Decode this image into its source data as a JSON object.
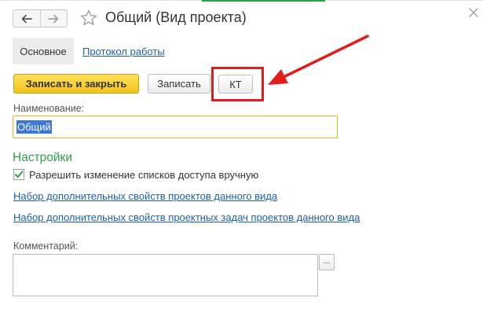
{
  "window": {
    "title": "Общий (Вид проекта)"
  },
  "icons": {
    "back": "arrow-left-icon",
    "forward": "arrow-right-icon",
    "favorite": "star-icon",
    "close": "close-icon",
    "checkbox": "checkmark-icon",
    "ellipsis": "ellipsis-icon"
  },
  "tabs": [
    {
      "label": "Основное",
      "active": true
    },
    {
      "label": "Протокол работы",
      "active": false
    }
  ],
  "toolbar": {
    "save_close_label": "Записать и закрыть",
    "save_label": "Записать",
    "kt_label": "КТ"
  },
  "form": {
    "name_label": "Наименование:",
    "name_value": "Общий",
    "settings_title": "Настройки",
    "allow_access_change_label": "Разрешить изменение списков доступа вручную",
    "allow_access_change_checked": true,
    "link_project_properties": "Набор дополнительных свойств проектов данного вида",
    "link_task_properties": "Набор дополнительных свойств проектных задач проектов данного вида",
    "comment_label": "Комментарий:",
    "comment_value": "",
    "ellipsis_label": "..."
  },
  "colors": {
    "accent_green": "#2f9e4a",
    "primary_button": "#f1c318",
    "link": "#1c5fac",
    "annotation_red": "#e21b1b",
    "selection": "#3b78d8"
  }
}
